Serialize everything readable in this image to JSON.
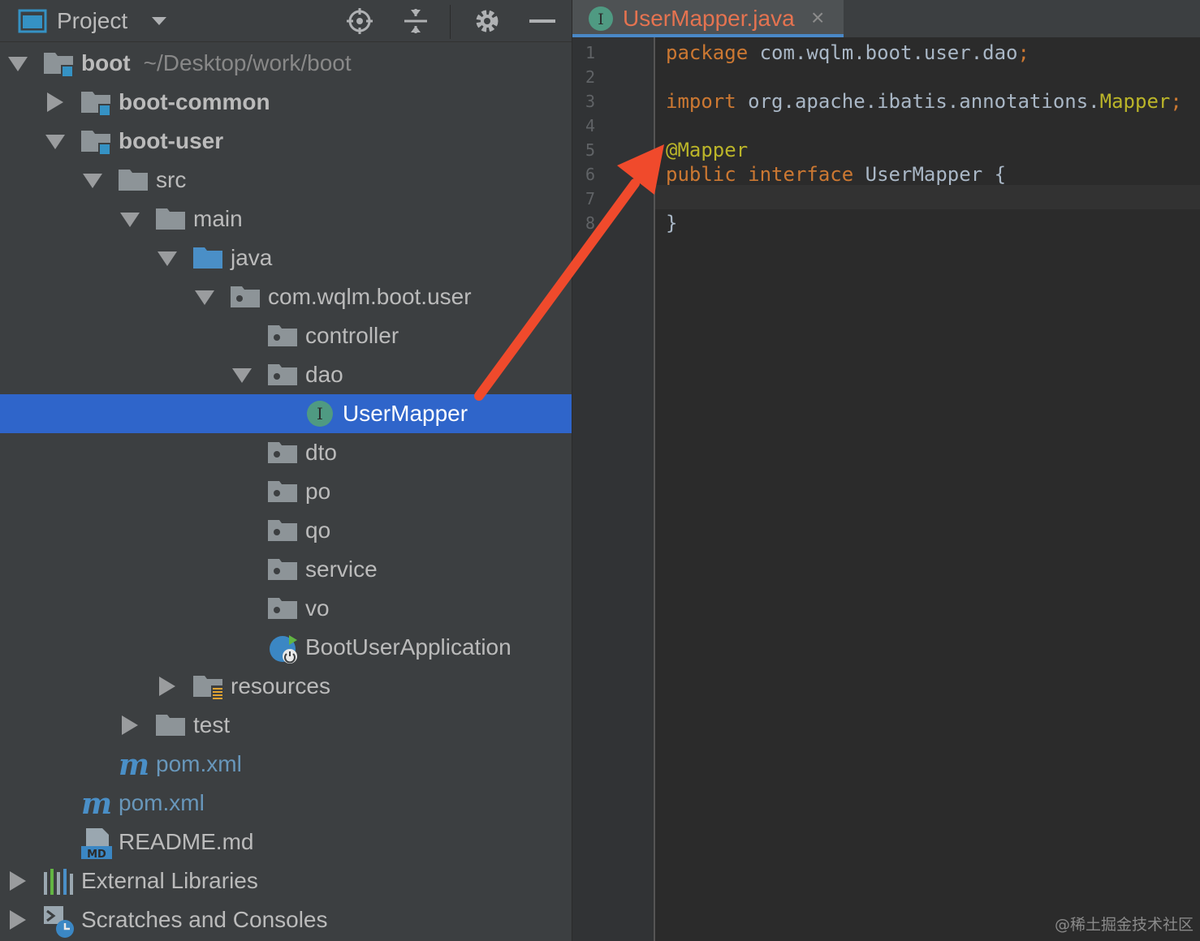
{
  "project_panel": {
    "title": "Project",
    "tree": [
      {
        "label": "boot",
        "path": "~/Desktop/work/boot"
      },
      {
        "label": "boot-common"
      },
      {
        "label": "boot-user"
      },
      {
        "label": "src"
      },
      {
        "label": "main"
      },
      {
        "label": "java"
      },
      {
        "label": "com.wqlm.boot.user"
      },
      {
        "label": "controller"
      },
      {
        "label": "dao"
      },
      {
        "label": "UserMapper"
      },
      {
        "label": "dto"
      },
      {
        "label": "po"
      },
      {
        "label": "qo"
      },
      {
        "label": "service"
      },
      {
        "label": "vo"
      },
      {
        "label": "BootUserApplication"
      },
      {
        "label": "resources"
      },
      {
        "label": "test"
      },
      {
        "label": "pom.xml"
      },
      {
        "label": "pom.xml"
      },
      {
        "label": "README.md"
      },
      {
        "label": "External Libraries"
      },
      {
        "label": "Scratches and Consoles"
      }
    ],
    "selected": "UserMapper"
  },
  "editor": {
    "tab": {
      "label": "UserMapper.java",
      "close": "×"
    },
    "line_numbers": [
      "1",
      "2",
      "3",
      "4",
      "5",
      "6",
      "7",
      "8"
    ],
    "code": {
      "l1_kw": "package",
      "l1_rest": " com.wqlm.boot.user.dao",
      "l1_semi": ";",
      "l3_kw": "import",
      "l3_rest": " org.apache.ibatis.annotations.",
      "l3_ann": "Mapper",
      "l3_semi": ";",
      "l5_ann": "@Mapper",
      "l6_kw1": "public",
      "l6_kw2": "interface",
      "l6_rest": " UserMapper {",
      "l8": "}"
    }
  },
  "watermark": "@稀土掘金技术社区",
  "colors": {
    "selection": "#2f65ca",
    "arrow": "#f04a2c",
    "keyword": "#cc7832",
    "annotation": "#bbb529"
  }
}
